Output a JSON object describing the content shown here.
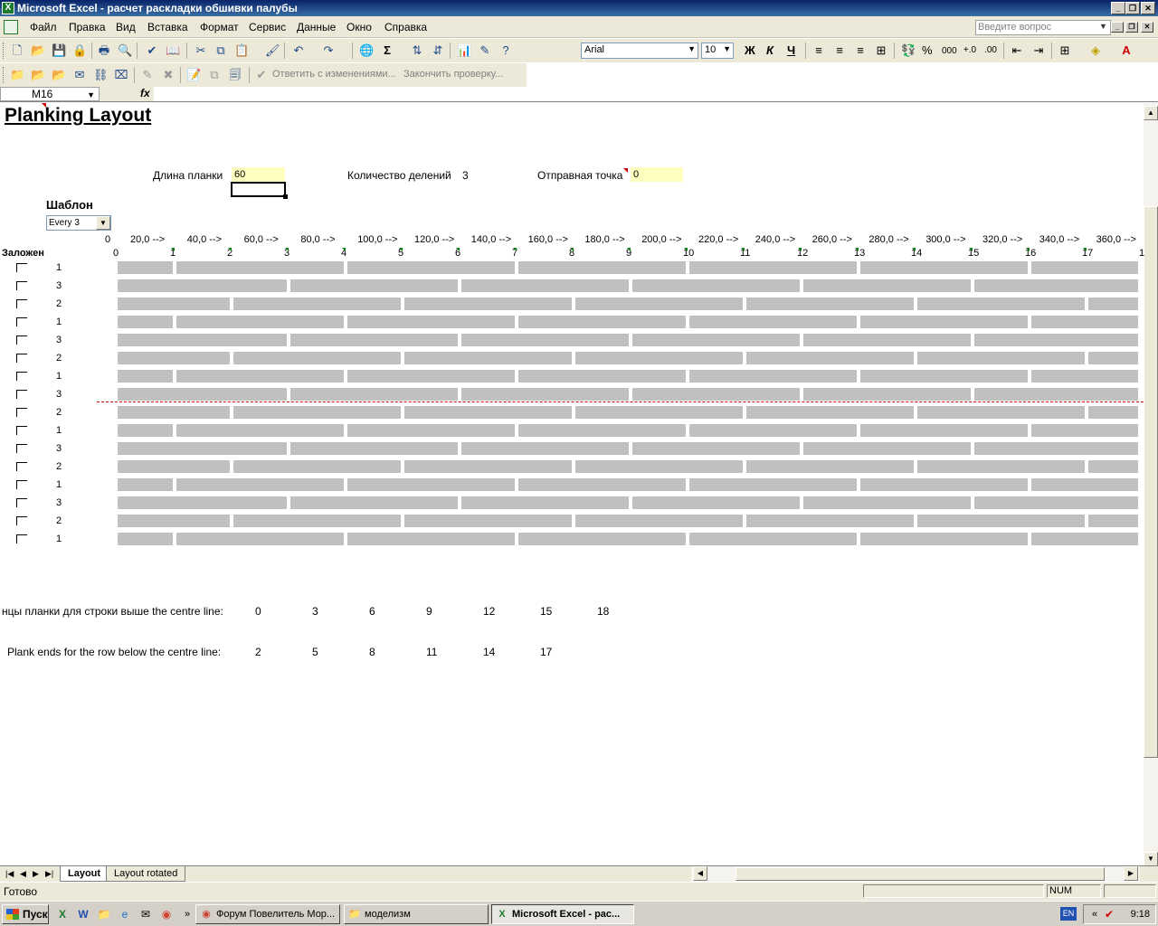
{
  "window": {
    "title": "Microsoft Excel - расчет раскладки обшивки палубы"
  },
  "menu": {
    "items": [
      "Файл",
      "Правка",
      "Вид",
      "Вставка",
      "Формат",
      "Сервис",
      "Данные",
      "Окно",
      "Справка"
    ],
    "ask_placeholder": "Введите вопрос"
  },
  "toolbar": {
    "font_name": "Arial",
    "font_size": "10",
    "bold_label": "Ж",
    "italic_label": "К",
    "underline_label": "Ч",
    "percent_label": "%",
    "thousands_label": "000",
    "review_reply": "Ответить с изменениями...",
    "review_end": "Закончить проверку..."
  },
  "formula": {
    "cell_ref": "M16",
    "fx_label": "fx",
    "value": ""
  },
  "sheet": {
    "title": "Planking Layout",
    "plank_length_label": "Длина планки",
    "plank_length_value": "60",
    "divisions_label": "Количество делений",
    "divisions_value": "3",
    "start_point_label": "Отправная точка",
    "start_point_value": "0",
    "pattern_label": "Шаблон",
    "pattern_value": "Every 3",
    "laid_label": "Заложен",
    "ruler_start": "0",
    "ruler_labels": [
      "20,0 -->",
      "40,0 -->",
      "60,0 -->",
      "80,0 -->",
      "100,0 -->",
      "120,0 -->",
      "140,0 -->",
      "160,0 -->",
      "180,0 -->",
      "200,0 -->",
      "220,0 -->",
      "240,0 -->",
      "260,0 -->",
      "280,0 -->",
      "300,0 -->",
      "320,0 -->",
      "340,0 -->",
      "360,0 -->"
    ],
    "tick_labels": [
      "0",
      "1",
      "2",
      "3",
      "4",
      "5",
      "6",
      "7",
      "8",
      "9",
      "10",
      "11",
      "12",
      "13",
      "14",
      "15",
      "16",
      "17",
      "1"
    ],
    "row_offsets": [
      "1",
      "3",
      "2",
      "1",
      "3",
      "2",
      "1",
      "3",
      "2",
      "1",
      "3",
      "2",
      "1",
      "3",
      "2",
      "1"
    ],
    "ends_above_label": "нцы планки для строки выше the centre line:",
    "ends_above_values": [
      "0",
      "3",
      "6",
      "9",
      "12",
      "15",
      "18"
    ],
    "ends_below_label": "Plank ends for the row below the centre line:",
    "ends_below_values": [
      "2",
      "5",
      "8",
      "11",
      "14",
      "17"
    ]
  },
  "tabs": {
    "items": [
      "Layout",
      "Layout rotated"
    ],
    "active": "Layout"
  },
  "status": {
    "text": "Готово",
    "num": "NUM"
  },
  "taskbar": {
    "start": "Пуск",
    "windows": [
      "Форум Повелитель Мор...",
      "моделизм",
      "Microsoft Excel - рас..."
    ],
    "lang": "EN",
    "clock": "9:18"
  },
  "colors": {
    "input_cell": "#ffffc0",
    "plank": "#c0c0c0",
    "centre_line": "#d00000"
  }
}
